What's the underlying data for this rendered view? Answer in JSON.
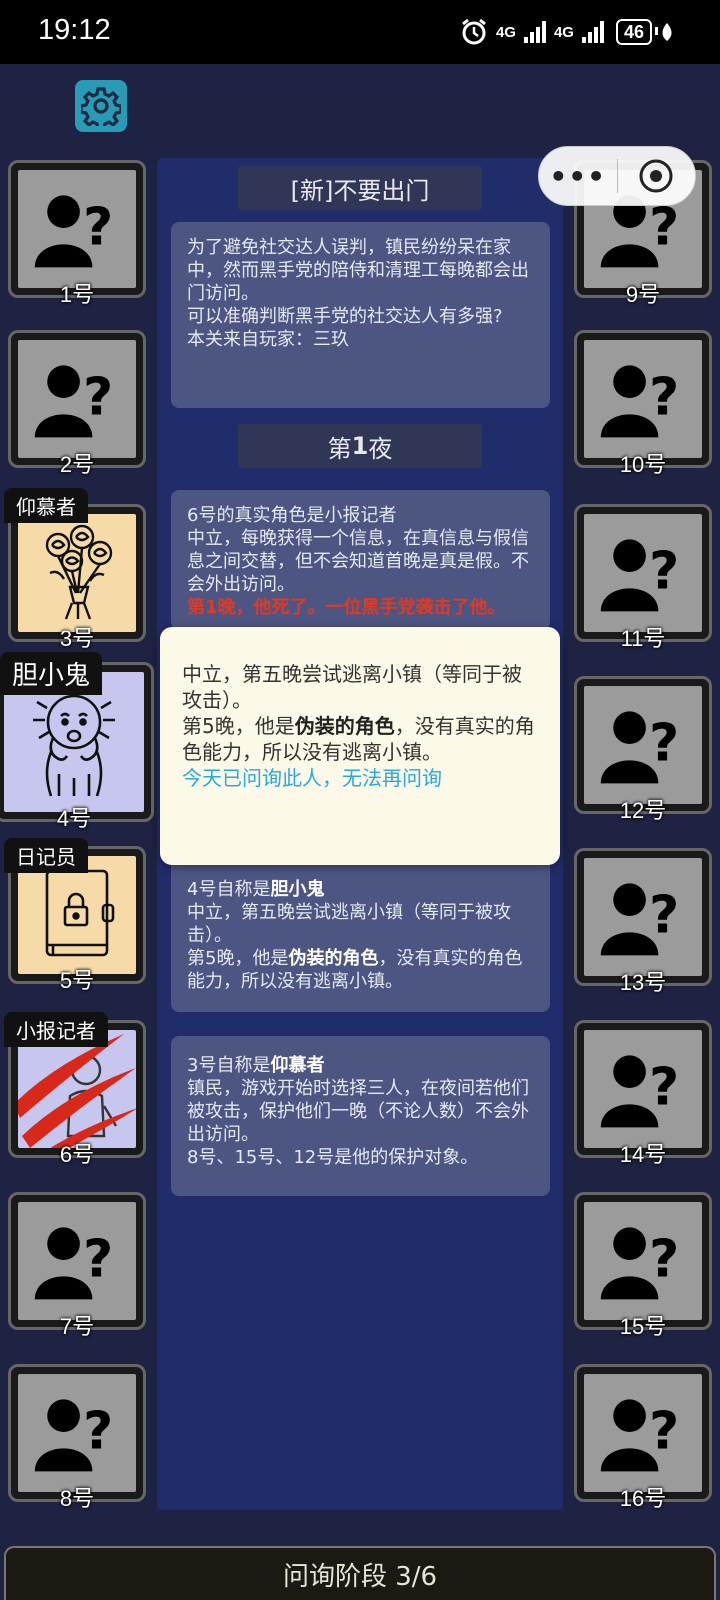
{
  "status_bar": {
    "time": "19:12",
    "net1": "4G",
    "net2": "4G",
    "battery": "46"
  },
  "settings_icon": "gear-icon",
  "capsule": {
    "more": "•••"
  },
  "panel": {
    "level_title": "[新]不要出门",
    "level_desc": [
      "为了避免社交达人误判，镇民纷纷呆在家中，然而黑手党的陪侍和清理工每晚都会出门访问。",
      "可以准确判断黑手党的社交达人有多强?",
      "本关来自玩家：三玖"
    ],
    "night_title_pre": "第",
    "night_title_num": "1",
    "night_title_post": "夜",
    "msg6": {
      "l1": "6号的真实角色是小报记者",
      "l2": "中立，每晚获得一个信息，在真信息与假信息之间交替，但不会知道首晚是真是假。不会外出访问。",
      "l3": "第1晚，他死了。一位黑手党袭击了他。"
    },
    "msg4": {
      "pre": "4号自称是",
      "role": "胆小鬼",
      "l2": "中立，第五晚尝试逃离小镇（等同于被攻击）。",
      "l3_pre": "第5晚，他是",
      "l3_b": "伪装的角色",
      "l3_post": "，没有真实的角色能力，所以没有逃离小镇。"
    },
    "msg3": {
      "pre": "3号自称是",
      "role": "仰慕者",
      "l2": "镇民，游戏开始时选择三人，在夜间若他们被攻击，保护他们一晚（不论人数）不会外出访问。",
      "l3": "8号、15号、12号是他的保护对象。"
    }
  },
  "popup": {
    "l1": "中立，第五晚尝试逃离小镇（等同于被攻击）。",
    "l2_pre": "第5晚，他是",
    "l2_b": "伪装的角色",
    "l2_post": "，没有真实的角色能力，所以没有逃离小镇。",
    "note": "今天已问询此人，无法再问询"
  },
  "players": {
    "p1": "1号",
    "p2": "2号",
    "p3": "3号",
    "p4": "4号",
    "p5": "5号",
    "p6": "6号",
    "p7": "7号",
    "p8": "8号",
    "p9": "9号",
    "p10": "10号",
    "p11": "11号",
    "p12": "12号",
    "p13": "13号",
    "p14": "14号",
    "p15": "15号",
    "p16": "16号"
  },
  "roles": {
    "p3": "仰慕者",
    "p4": "胆小鬼",
    "p5": "日记员",
    "p6": "小报记者"
  },
  "phase": "问询阶段 3/6",
  "colors": {
    "background": "#1e2243",
    "panel": "#212c6a",
    "card": "#4d5683",
    "unknown_tile": "#9b9b9b",
    "tile_admirer": "#f6dba8",
    "tile_coward": "#c6c6ee",
    "attack_red": "#d8281a",
    "popup_bg": "#fdf9e8",
    "popup_note": "#29a8dc"
  }
}
